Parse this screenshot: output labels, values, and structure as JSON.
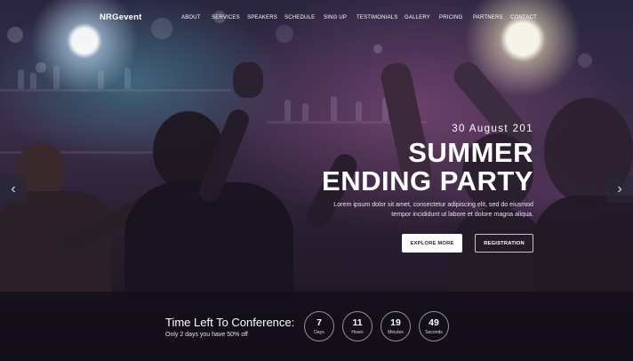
{
  "brand": {
    "logo": "NRGevent"
  },
  "nav": {
    "items": [
      "ABOUT",
      "SERVICES",
      "SPEAKERS",
      "SCHEDULE",
      "SING UP",
      "TESTIMONIALS",
      "GALLERY",
      "PRICING",
      "PARTNERS",
      "CONTACT"
    ]
  },
  "hero": {
    "date": "30 August 201",
    "title_line1": "SUMMER",
    "title_line2": "ENDING PARTY",
    "description_line1": "Lorem ipsum dolor sit amet, consectetur adipiscing elit, sed do eiusmod",
    "description_line2": "tempor incididunt ut labore et dolore magna aliqua.",
    "explore_label": "EXPLORE MORE",
    "register_label": "REGISTRATION"
  },
  "slider": {
    "prev_icon": "chevron-left-icon",
    "next_icon": "chevron-right-icon",
    "prev_glyph": "‹",
    "next_glyph": "›"
  },
  "countdown": {
    "title": "Time Left To Conference:",
    "subtitle": "Only 2 days you have 50% off",
    "units": [
      {
        "value": "7",
        "label": "Days"
      },
      {
        "value": "11",
        "label": "Hours"
      },
      {
        "value": "19",
        "label": "Minutes"
      },
      {
        "value": "49",
        "label": "Seconds"
      }
    ]
  },
  "colors": {
    "explore_bg": "#ffffff",
    "overlay": "#120e18"
  }
}
